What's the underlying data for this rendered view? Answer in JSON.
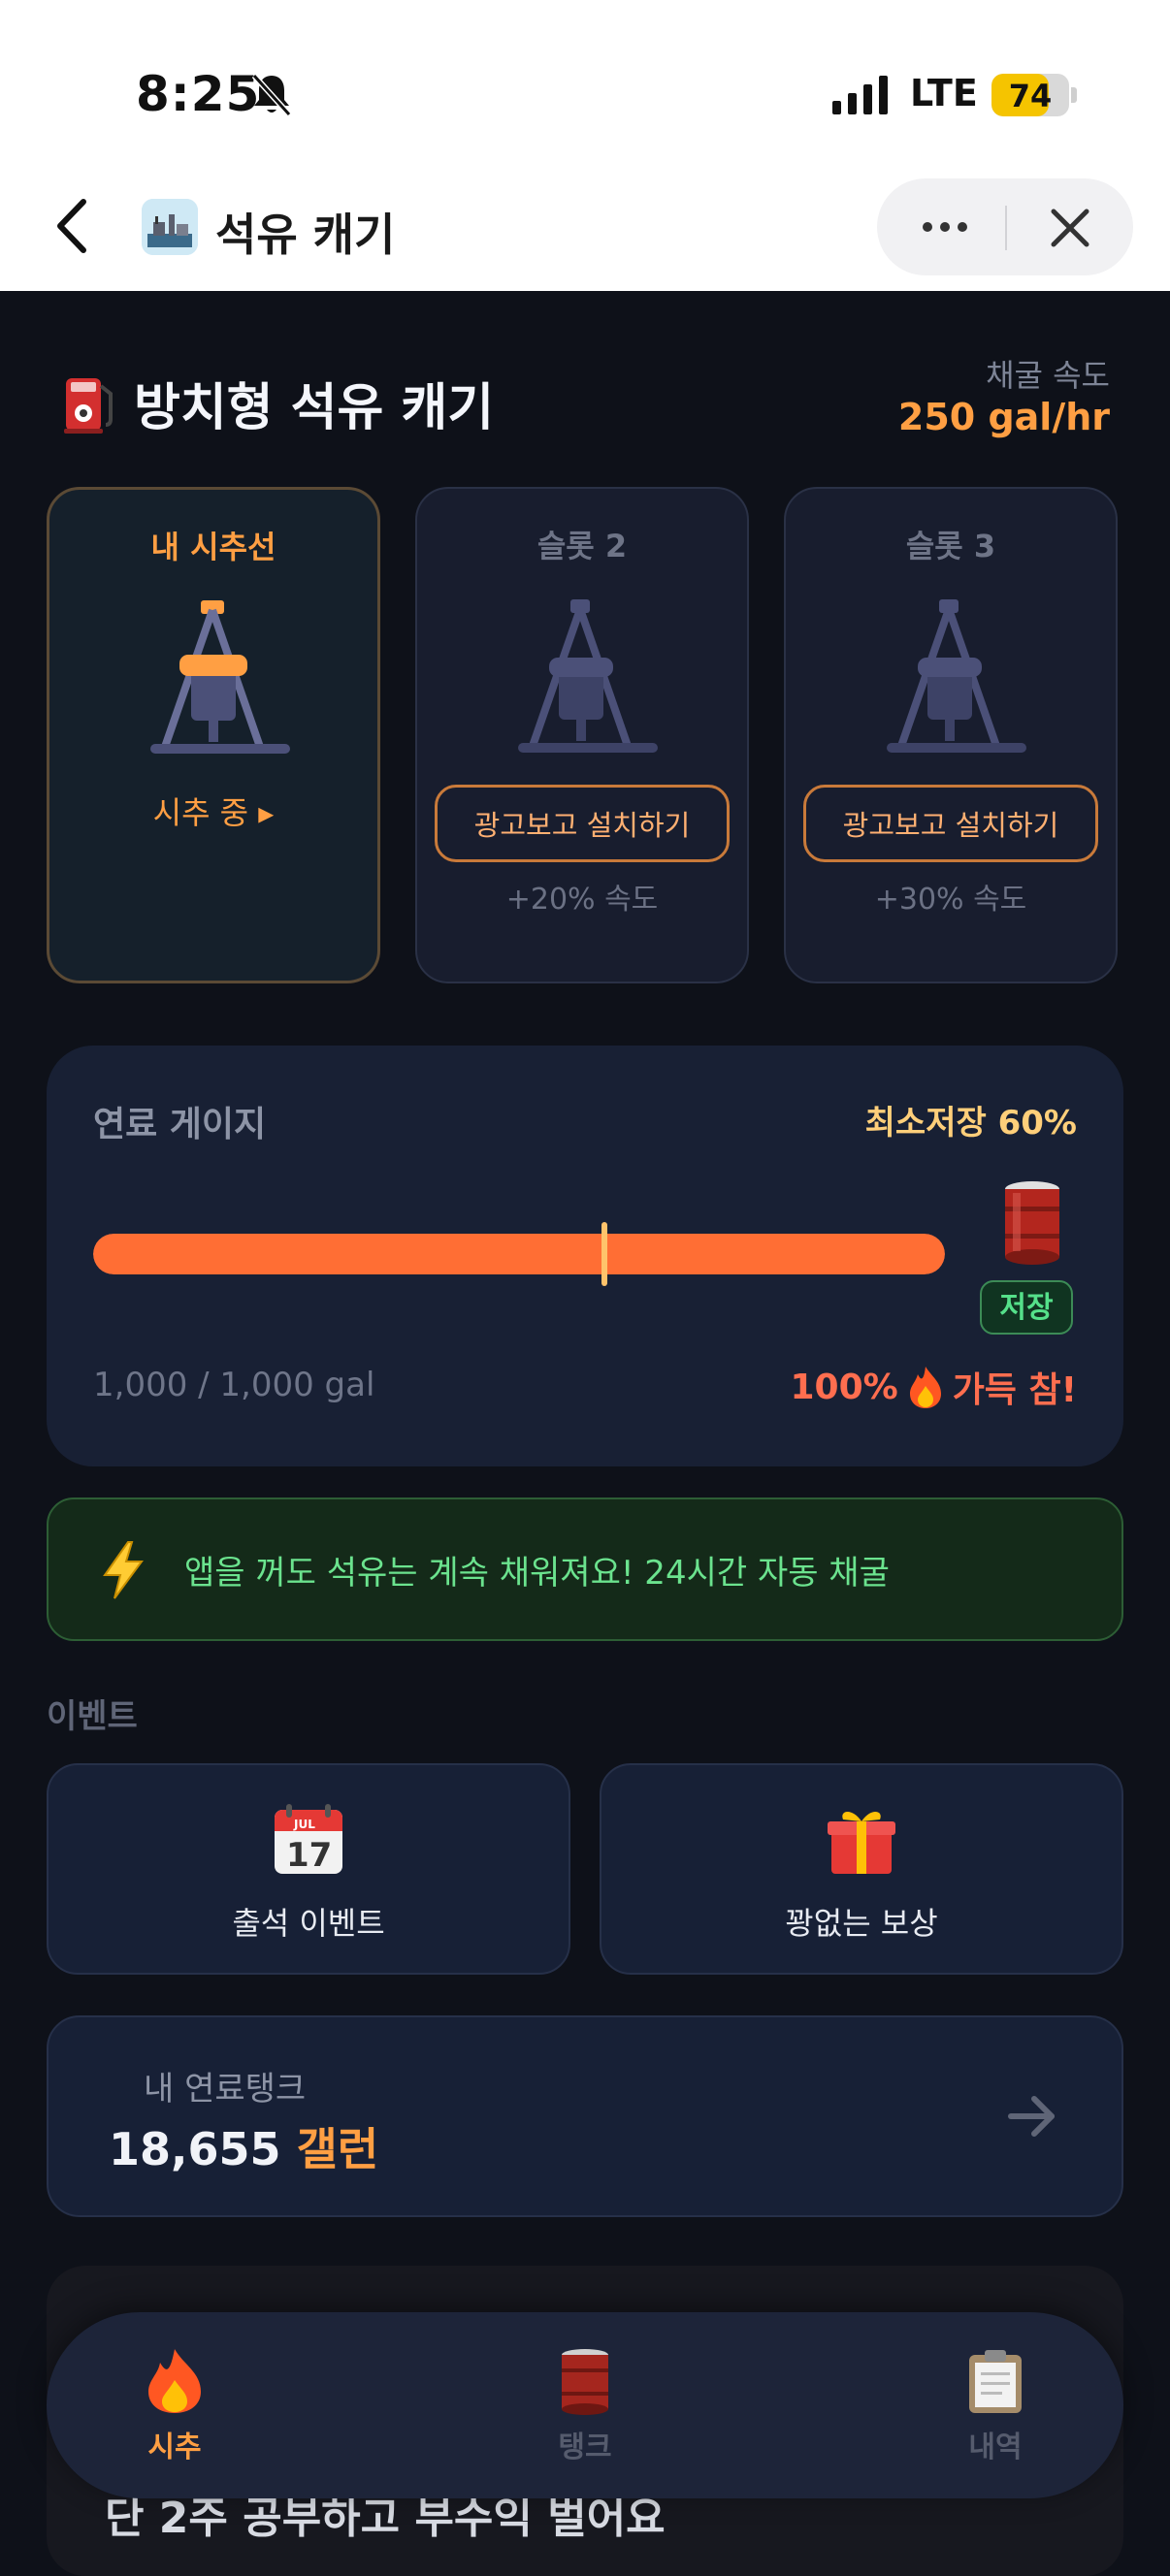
{
  "status_bar": {
    "time": "8:25",
    "network": "LTE",
    "battery": "74",
    "battery_level": 0.74
  },
  "nav": {
    "title": "석유 캐기"
  },
  "header": {
    "title": "방치형 석유 캐기",
    "rate_label": "채굴 속도",
    "rate_value": "250 gal/hr"
  },
  "slots": [
    {
      "label": "내 시추선",
      "status": "시추 중 ▸"
    },
    {
      "label": "슬롯 2",
      "button": "광고보고 설치하기",
      "bonus": "+20% 속도"
    },
    {
      "label": "슬롯 3",
      "button": "광고보고 설치하기",
      "bonus": "+30% 속도"
    }
  ],
  "gauge": {
    "title": "연료 게이지",
    "min_storage": "최소저장 60%",
    "fill_fraction": 1.0,
    "marker_fraction": 0.6,
    "store_label": "저장",
    "amount": "1,000 / 1,000 gal",
    "full_percent": "100%",
    "full_label": "가득 참!"
  },
  "notice": {
    "text": "앱을 꺼도 석유는 계속 채워져요! 24시간 자동 채굴"
  },
  "events": {
    "section": "이벤트",
    "items": [
      {
        "label": "출석 이벤트",
        "icon": "calendar-icon",
        "cal_month": "JUL",
        "cal_day": "17"
      },
      {
        "label": "꽝없는 보상",
        "icon": "gift-icon"
      }
    ]
  },
  "tank": {
    "label": "내 연료탱크",
    "value": "18,655",
    "unit": "갤런"
  },
  "peek": {
    "text": "단 2주 공부하고 부수익 벌어요"
  },
  "tabs": [
    {
      "label": "시추",
      "icon": "fire-icon",
      "active": true
    },
    {
      "label": "탱크",
      "icon": "barrel-icon",
      "active": false
    },
    {
      "label": "내역",
      "icon": "clipboard-icon",
      "active": false
    }
  ],
  "colors": {
    "accent": "#ff9f43",
    "gauge_fill": "#ff6e34",
    "notice_text": "#6be38e",
    "background": "#0e1119"
  }
}
